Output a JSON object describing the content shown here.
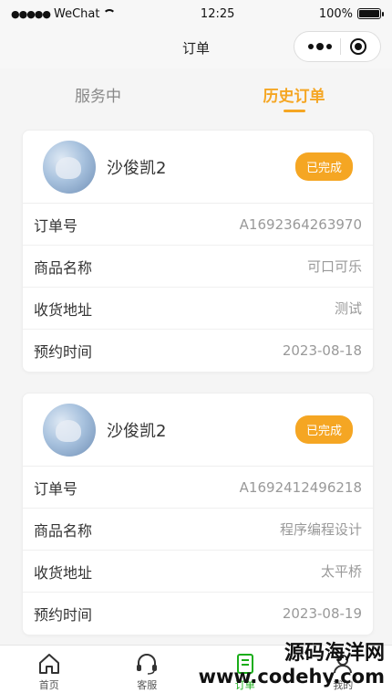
{
  "status_bar": {
    "carrier": "WeChat",
    "time": "12:25",
    "battery": "100%",
    "battery_level": 1.0
  },
  "nav": {
    "title": "订单"
  },
  "tabs": [
    {
      "label": "服务中"
    },
    {
      "label": "历史订单"
    }
  ],
  "orders": [
    {
      "user_name": "沙俊凯2",
      "status": "已完成",
      "rows": [
        {
          "label": "订单号",
          "value": "A1692364263970"
        },
        {
          "label": "商品名称",
          "value": "可口可乐"
        },
        {
          "label": "收货地址",
          "value": "测试"
        },
        {
          "label": "预约时间",
          "value": "2023-08-18"
        }
      ]
    },
    {
      "user_name": "沙俊凯2",
      "status": "已完成",
      "rows": [
        {
          "label": "订单号",
          "value": "A1692412496218"
        },
        {
          "label": "商品名称",
          "value": "程序编程设计"
        },
        {
          "label": "收货地址",
          "value": "太平桥"
        },
        {
          "label": "预约时间",
          "value": "2023-08-19"
        }
      ]
    }
  ],
  "tabbar": [
    {
      "label": "首页",
      "icon": "home-icon"
    },
    {
      "label": "客服",
      "icon": "headset-icon"
    },
    {
      "label": "订单",
      "icon": "order-icon"
    },
    {
      "label": "我的",
      "icon": "user-icon"
    }
  ],
  "watermark": {
    "name": "源码海洋网",
    "url": "www.codehy.com"
  },
  "colors": {
    "accent": "#f5a623",
    "active_tab_green": "#1aad19"
  }
}
